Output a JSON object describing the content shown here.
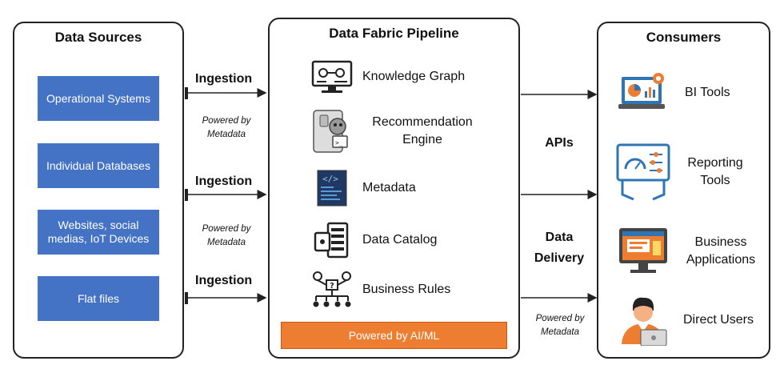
{
  "sources": {
    "title": "Data Sources",
    "items": [
      "Operational Systems",
      "Individual Databases",
      "Websites, social medias, IoT Devices",
      "Flat files"
    ]
  },
  "connectors_left": {
    "labels": [
      "Ingestion",
      "Ingestion",
      "Ingestion"
    ],
    "metadata": [
      "Powered by Metadata",
      "Powered by Metadata"
    ]
  },
  "pipeline": {
    "title": "Data Fabric Pipeline",
    "items": [
      {
        "label": "Knowledge Graph",
        "icon": "knowledge-graph-icon"
      },
      {
        "label": "Recommendation Engine",
        "icon": "robot-icon"
      },
      {
        "label": "Metadata",
        "icon": "code-document-icon"
      },
      {
        "label": "Data Catalog",
        "icon": "data-catalog-icon"
      },
      {
        "label": "Business Rules",
        "icon": "business-rules-icon"
      }
    ],
    "footer": "Powered by AI/ML"
  },
  "connectors_right": {
    "apis": "APIs",
    "delivery": "Data Delivery",
    "metadata": "Powered by Metadata"
  },
  "consumers": {
    "title": "Consumers",
    "items": [
      {
        "label": "BI Tools",
        "icon": "bi-tools-icon"
      },
      {
        "label": "Reporting Tools",
        "icon": "reporting-tools-icon"
      },
      {
        "label": "Business Applications",
        "icon": "business-applications-icon"
      },
      {
        "label": "Direct Users",
        "icon": "user-laptop-icon"
      }
    ]
  },
  "colors": {
    "source_box": "#4472c4",
    "ai_bar": "#ed7d31",
    "icon_blue": "#2e75b6",
    "icon_orange": "#ed7d31"
  }
}
